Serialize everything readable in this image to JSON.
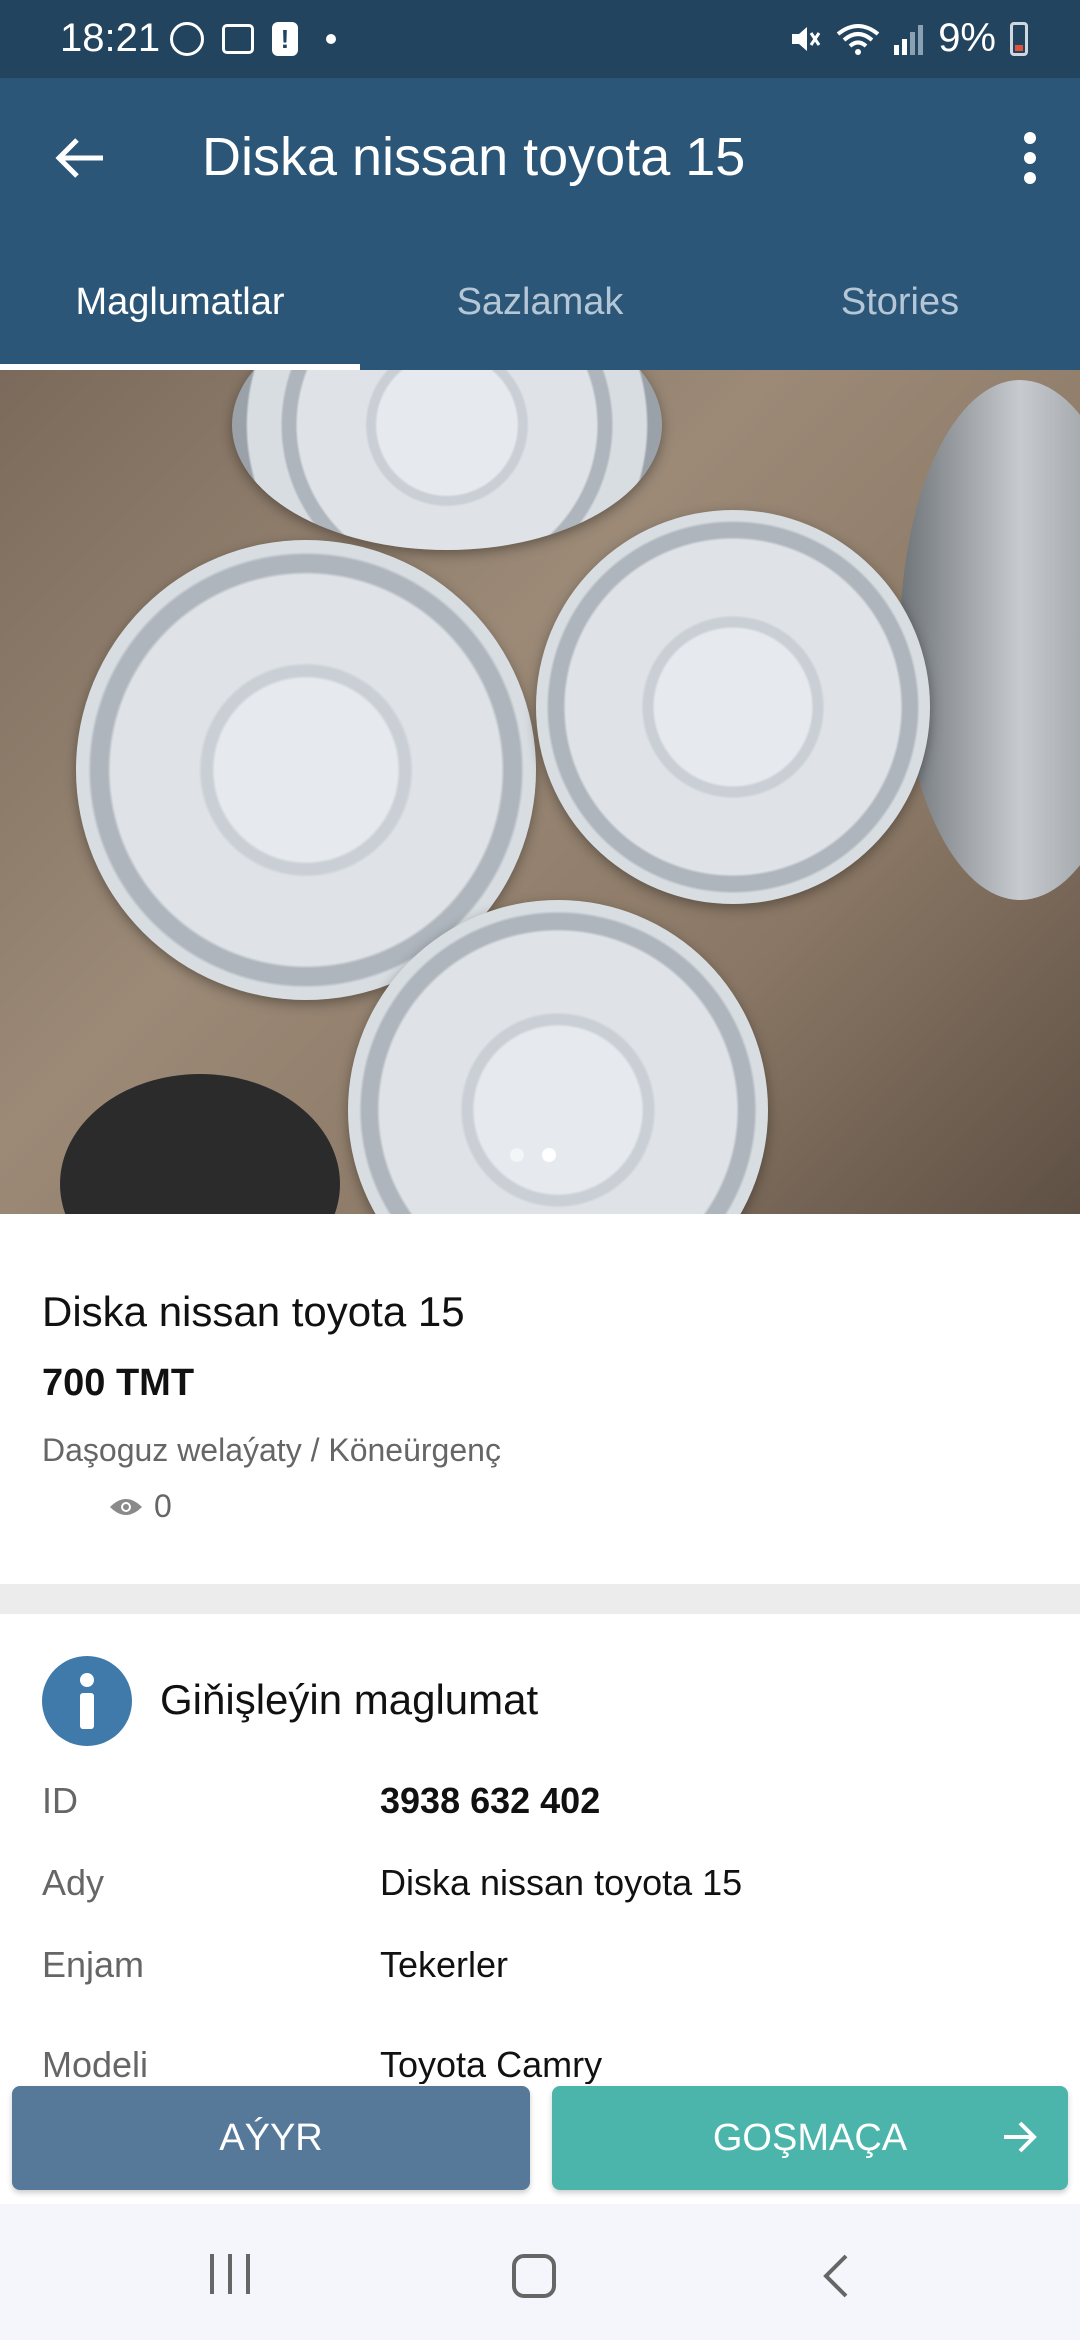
{
  "status_bar": {
    "time": "18:21",
    "battery": "9%"
  },
  "app_bar": {
    "title": "Diska nissan toyota 15"
  },
  "tabs": [
    {
      "label": "Maglumatlar",
      "active": true
    },
    {
      "label": "Sazlamak",
      "active": false
    },
    {
      "label": "Stories",
      "active": false
    }
  ],
  "gallery": {
    "slide_count": 2,
    "current_slide": 2
  },
  "listing": {
    "title": "Diska nissan toyota 15",
    "price": "700 TMT",
    "location": "Daşoguz welaýaty / Köneürgenç",
    "views": "0"
  },
  "details": {
    "heading": "Giňişleýin maglumat",
    "rows": [
      {
        "key": "ID",
        "value": "3938 632 402"
      },
      {
        "key": "Ady",
        "value": "Diska nissan toyota 15"
      },
      {
        "key": "Enjam",
        "value": "Tekerler"
      },
      {
        "key": "Modeli",
        "value": "Toyota Camry"
      }
    ]
  },
  "actions": {
    "remove_label": "AÝYR",
    "add_label": "GOŞMAÇA"
  },
  "colors": {
    "app_bar": "#2b5677",
    "status_bar": "#23445e",
    "remove_button": "#56799a",
    "add_button": "#4bb5ab",
    "info_icon": "#3f7aaa"
  },
  "icons": [
    "imo-icon",
    "gallery-icon",
    "alert-icon",
    "mute-icon",
    "wifi-icon",
    "signal-icon",
    "battery-icon",
    "back-arrow-icon",
    "more-vert-icon",
    "eye-icon",
    "info-icon",
    "arrow-right-icon",
    "recents-icon",
    "home-icon",
    "nav-back-icon"
  ]
}
